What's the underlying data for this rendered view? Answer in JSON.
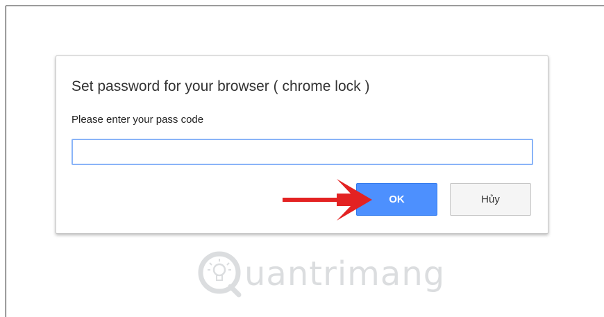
{
  "dialog": {
    "title": "Set password for your browser ( chrome lock )",
    "prompt": "Please enter your pass code",
    "input_value": "",
    "ok_label": "OK",
    "cancel_label": "Hủy"
  },
  "watermark": {
    "text": "uantrimang"
  },
  "colors": {
    "ok_button": "#4d90fe",
    "input_border": "#8ab4f8",
    "arrow": "#e32222"
  }
}
